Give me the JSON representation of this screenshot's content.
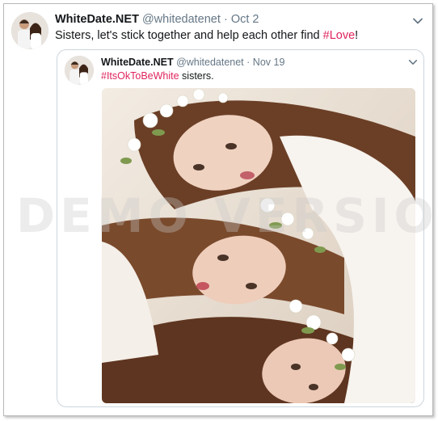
{
  "tweet": {
    "display_name": "WhiteDate.NET",
    "handle": "@whitedatenet",
    "separator": "·",
    "date": "Oct 2",
    "text_before": "Sisters, let's stick together and help each other find ",
    "hashtag": "#Love",
    "text_after": "!",
    "menu_icon": "chevron-down-icon",
    "avatar_icon": "profile-photo"
  },
  "quoted_tweet": {
    "display_name": "WhiteDate.NET",
    "handle": "@whitedatenet",
    "separator": "·",
    "date": "Nov 19",
    "hashtag": "#ItsOkToBeWhite",
    "text_after": " sisters.",
    "menu_icon": "chevron-down-icon",
    "avatar_icon": "profile-photo",
    "media": "photo"
  },
  "watermark": "DEMO VERSION",
  "colors": {
    "hashtag": "#e0245e",
    "meta_text": "#657786",
    "primary_text": "#14171a",
    "card_border": "#ccd6dd"
  }
}
